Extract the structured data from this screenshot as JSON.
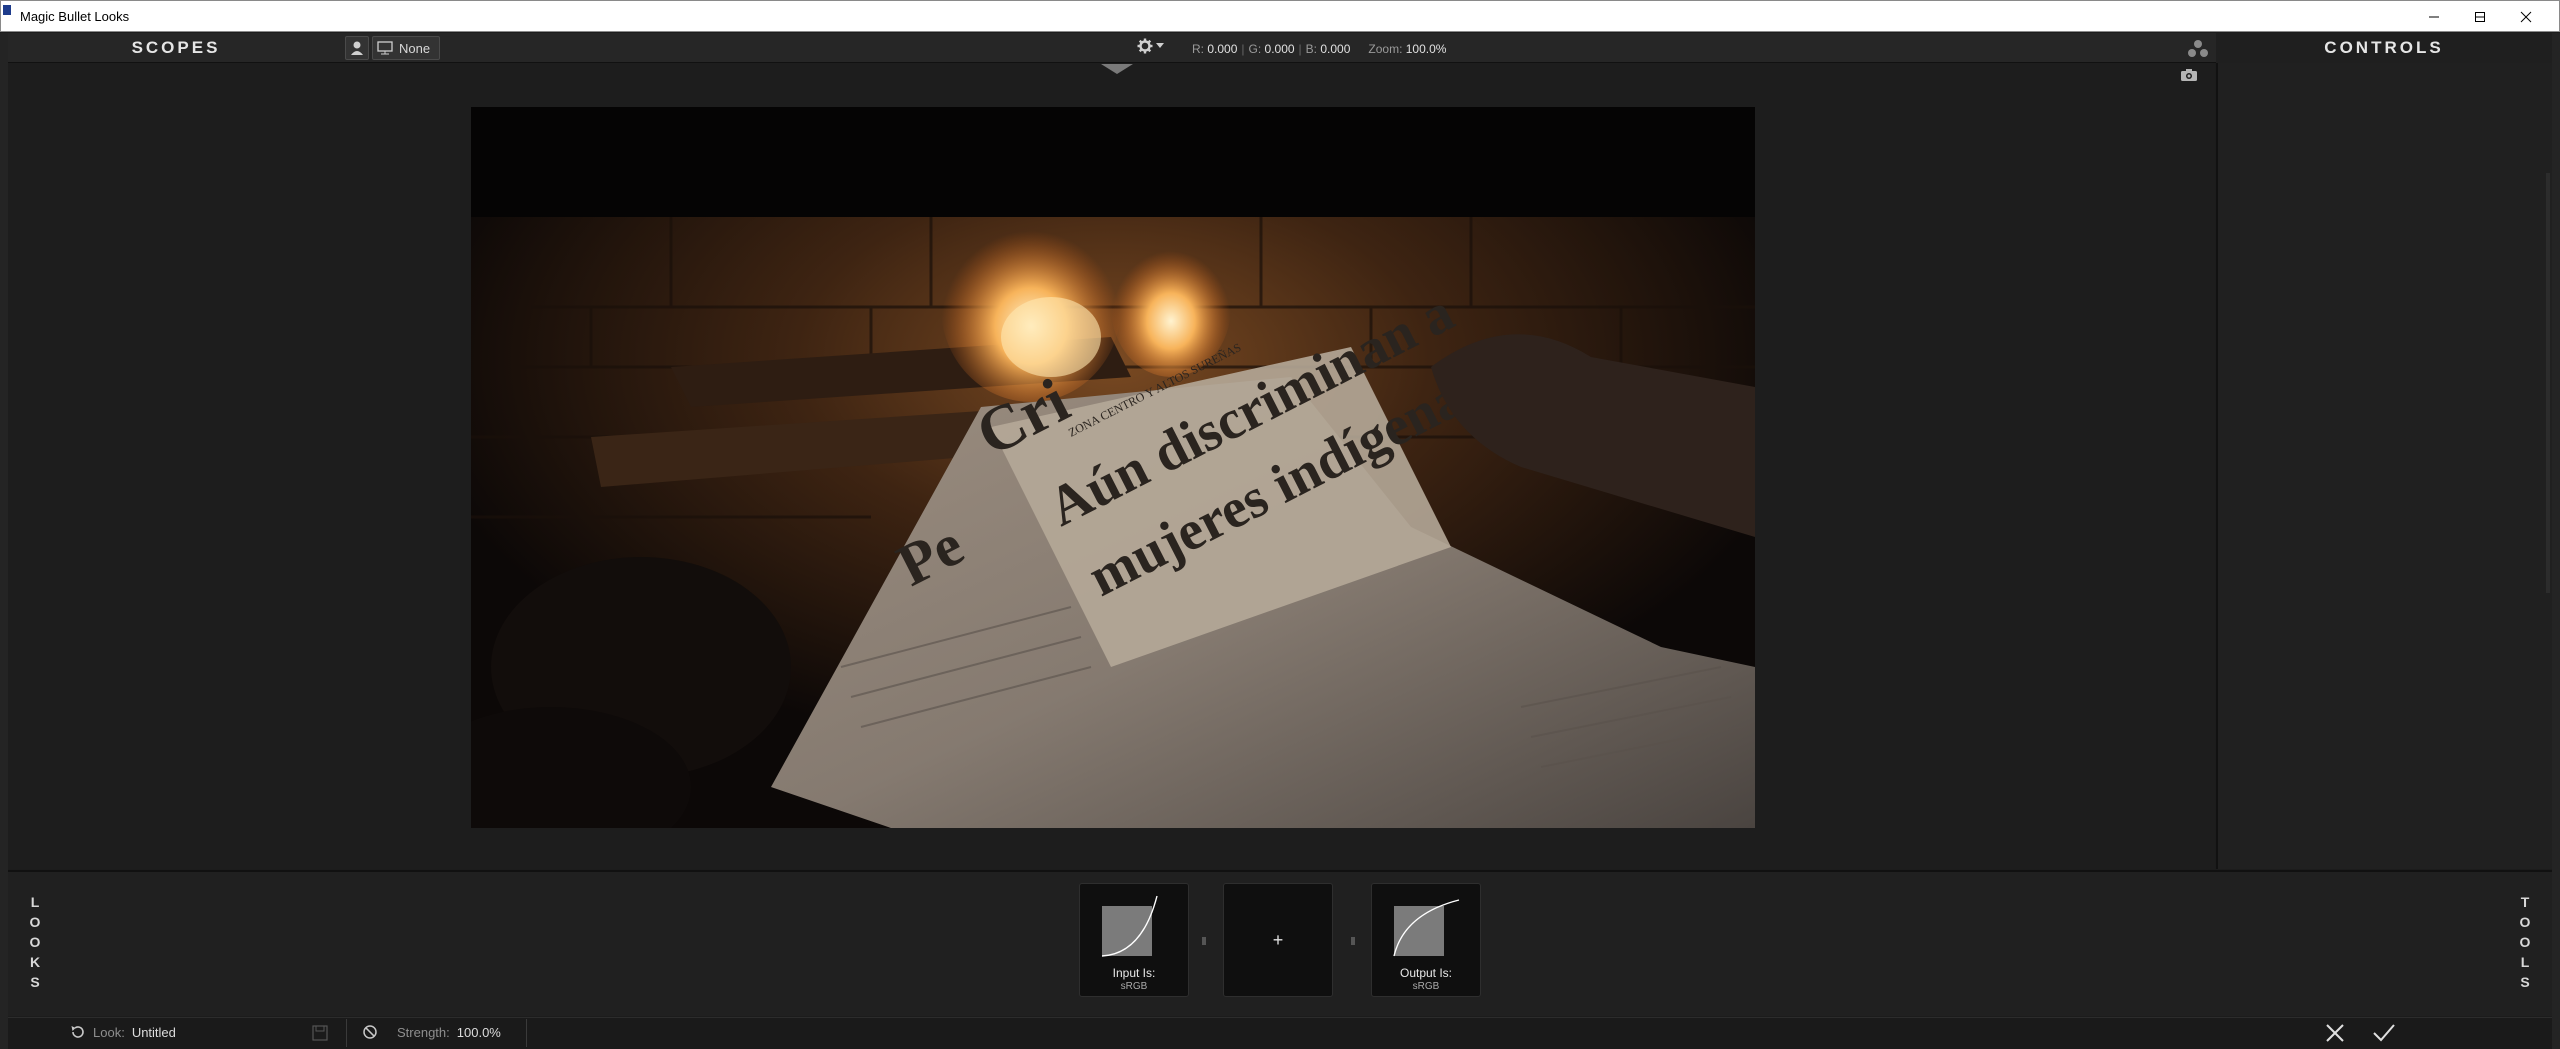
{
  "window": {
    "title": "Magic Bullet Looks"
  },
  "header": {
    "scopes_label": "SCOPES",
    "controls_label": "CONTROLS",
    "monitor_value": "None",
    "readout": {
      "r_label": "R:",
      "r_value": "0.000",
      "g_label": "G:",
      "g_value": "0.000",
      "b_label": "B:",
      "b_value": "0.000",
      "zoom_label": "Zoom:",
      "zoom_value": "100.0%"
    }
  },
  "image": {
    "headline_line1": "Aún discriminan a",
    "headline_line2": "mujeres indígenas",
    "big_letters": "Cri",
    "big_letters2": "Pe",
    "kicker": "ZONA CENTRO Y ALTOS SUREÑAS"
  },
  "chain": {
    "looks_letters": [
      "L",
      "O",
      "O",
      "K",
      "S"
    ],
    "tools_letters": [
      "T",
      "O",
      "O",
      "L",
      "S"
    ],
    "input_label": "Input Is:",
    "input_value": "sRGB",
    "add_label": "+",
    "output_label": "Output Is:",
    "output_value": "sRGB"
  },
  "status": {
    "look_label": "Look:",
    "look_value": "Untitled",
    "strength_label": "Strength:",
    "strength_value": "100.0%"
  }
}
